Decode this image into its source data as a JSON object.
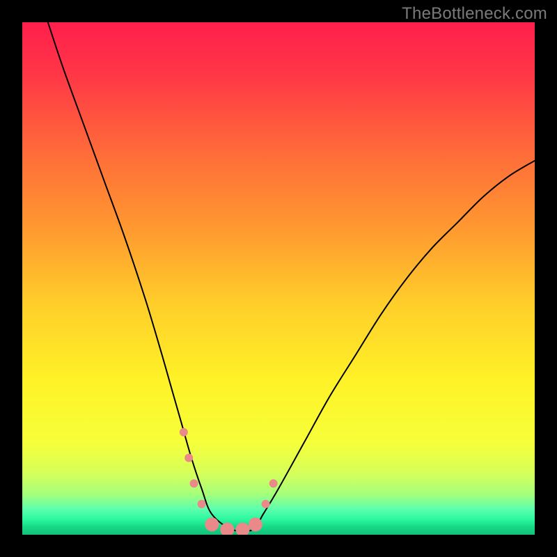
{
  "watermark": {
    "text": "TheBottleneck.com"
  },
  "chart_data": {
    "type": "line",
    "title": "",
    "xlabel": "",
    "ylabel": "",
    "xlim": [
      0,
      100
    ],
    "ylim": [
      0,
      100
    ],
    "grid": false,
    "legend": false,
    "background": {
      "kind": "vertical-gradient",
      "stops": [
        {
          "pos": 0.0,
          "color": "#ff1f4c"
        },
        {
          "pos": 0.1,
          "color": "#ff3647"
        },
        {
          "pos": 0.25,
          "color": "#ff6a3a"
        },
        {
          "pos": 0.4,
          "color": "#ff9830"
        },
        {
          "pos": 0.55,
          "color": "#ffce2a"
        },
        {
          "pos": 0.7,
          "color": "#fff227"
        },
        {
          "pos": 0.82,
          "color": "#f6ff3a"
        },
        {
          "pos": 0.88,
          "color": "#d6ff5a"
        },
        {
          "pos": 0.92,
          "color": "#a6ff7a"
        },
        {
          "pos": 0.96,
          "color": "#5dffad"
        },
        {
          "pos": 1.0,
          "color": "#18e branding"
        }
      ]
    },
    "series": [
      {
        "name": "bottleneck-curve",
        "stroke": "#000000",
        "stroke_width": 2,
        "x": [
          5,
          8,
          12,
          16,
          20,
          24,
          27,
          29,
          31,
          33,
          35,
          37,
          41,
          45,
          47,
          50,
          55,
          60,
          65,
          70,
          75,
          80,
          85,
          90,
          95,
          100
        ],
        "y": [
          100,
          91,
          80,
          69,
          58,
          46,
          36,
          29,
          22,
          15,
          9,
          4,
          1,
          1,
          4,
          9,
          18,
          27,
          35,
          43,
          50,
          56,
          61,
          66,
          70,
          73
        ]
      }
    ],
    "markers": {
      "name": "highlight-dots",
      "color": "#e98989",
      "radius_small": 6,
      "radius_large": 10,
      "points": [
        {
          "x": 31.5,
          "y": 20,
          "r": "small"
        },
        {
          "x": 32.5,
          "y": 15,
          "r": "small"
        },
        {
          "x": 33.5,
          "y": 10,
          "r": "small"
        },
        {
          "x": 35.0,
          "y": 6,
          "r": "small"
        },
        {
          "x": 37.0,
          "y": 2,
          "r": "large"
        },
        {
          "x": 40.0,
          "y": 1,
          "r": "large"
        },
        {
          "x": 43.0,
          "y": 1,
          "r": "large"
        },
        {
          "x": 45.5,
          "y": 2,
          "r": "large"
        },
        {
          "x": 47.5,
          "y": 6,
          "r": "small"
        },
        {
          "x": 49.0,
          "y": 10,
          "r": "small"
        }
      ]
    }
  }
}
